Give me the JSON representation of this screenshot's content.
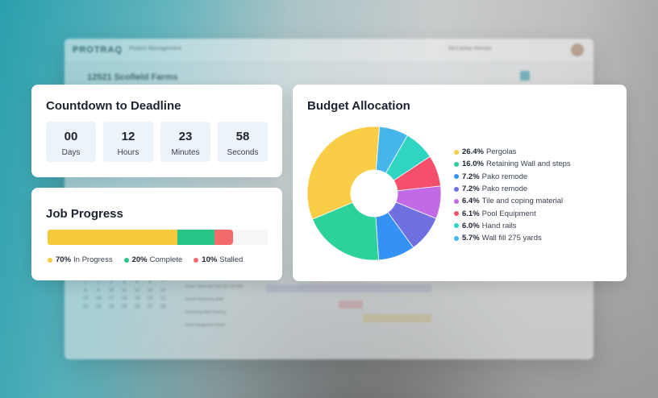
{
  "background": {
    "logo": "PROTRAQ",
    "module": "Project Management",
    "client": "McCarley Homes",
    "project_title": "12521 Scofield Farms",
    "calendar": [
      "1",
      "2",
      "3",
      "4",
      "5",
      "6",
      "7",
      "8",
      "9",
      "10",
      "11",
      "12",
      "13",
      "14",
      "15",
      "16",
      "17",
      "18",
      "19",
      "20",
      "21",
      "22",
      "23",
      "24",
      "25",
      "26",
      "27",
      "28"
    ],
    "rows": [
      "Clear Trees and Set Up Job Site",
      "Install Retaining Wall",
      "Retaining Wall Footing",
      "Pool Equipment Order"
    ]
  },
  "countdown": {
    "title": "Countdown to Deadline",
    "units": [
      {
        "value": "00",
        "label": "Days"
      },
      {
        "value": "12",
        "label": "Hours"
      },
      {
        "value": "23",
        "label": "Minutes"
      },
      {
        "value": "58",
        "label": "Seconds"
      }
    ]
  },
  "job_progress": {
    "title": "Job Progress",
    "segments": [
      {
        "pct": "70%",
        "label": "In Progress",
        "value": 70,
        "color": "#f7ca3c"
      },
      {
        "pct": "20%",
        "label": "Complete",
        "value": 20,
        "color": "#26c486"
      },
      {
        "pct": "10%",
        "label": "Stalled",
        "value": 10,
        "color": "#f46b6b"
      }
    ]
  },
  "budget": {
    "title": "Budget Allocation",
    "items": [
      {
        "pct": "26.4%",
        "label": "Pergolas",
        "value": 26.4,
        "color": "#f9cd45"
      },
      {
        "pct": "16.0%",
        "label": "Retaining Wall and steps",
        "value": 16.0,
        "color": "#2dd19a"
      },
      {
        "pct": "7.2%",
        "label": "Pako remode",
        "value": 7.2,
        "color": "#3491f5"
      },
      {
        "pct": "7.2%",
        "label": "Pako remode",
        "value": 7.2,
        "color": "#6e6fe0"
      },
      {
        "pct": "6.4%",
        "label": "Tile and coping material",
        "value": 6.4,
        "color": "#c16ae6"
      },
      {
        "pct": "6.1%",
        "label": "Pool Equipment",
        "value": 6.1,
        "color": "#f5506b"
      },
      {
        "pct": "6.0%",
        "label": "Hand rails",
        "value": 6.0,
        "color": "#2fd4c3"
      },
      {
        "pct": "5.7%",
        "label": "Wall fill 275 yards",
        "value": 5.7,
        "color": "#46b5ec"
      }
    ]
  }
}
